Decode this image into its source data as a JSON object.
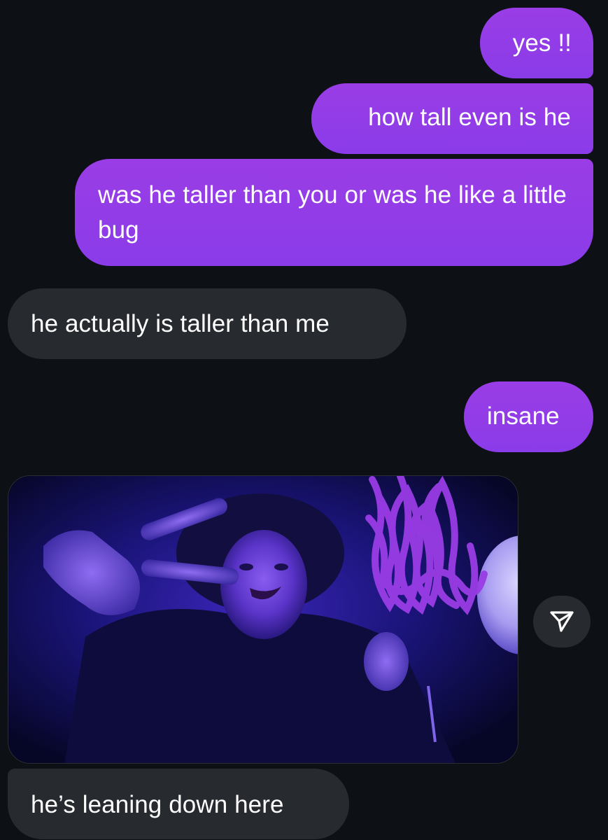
{
  "messages": {
    "m1": "yes !!",
    "m2": "how tall even is he",
    "m3": "was he taller than you or was he like a little bug",
    "m4": "he actually is taller than me",
    "m5": "insane",
    "m6": "he’s leaning down here"
  },
  "photo": {
    "description_icon": "photo-message",
    "scribble_color": "#9a3de6"
  },
  "actions": {
    "share_icon": "send-arrow-icon"
  },
  "colors": {
    "background": "#0d1014",
    "sent_bubble": "#8b3be6",
    "received_bubble": "#272a2f",
    "text": "#ffffff"
  }
}
